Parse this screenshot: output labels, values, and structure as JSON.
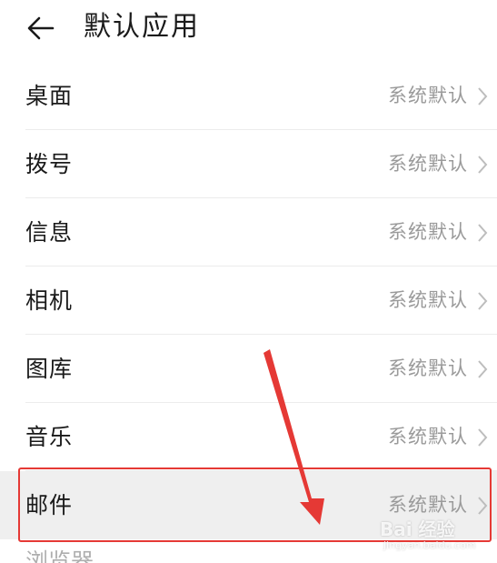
{
  "header": {
    "back_icon": "arrow-left-icon",
    "title": "默认应用"
  },
  "items": [
    {
      "label": "桌面",
      "value": "系统默认"
    },
    {
      "label": "拨号",
      "value": "系统默认"
    },
    {
      "label": "信息",
      "value": "系统默认"
    },
    {
      "label": "相机",
      "value": "系统默认"
    },
    {
      "label": "图库",
      "value": "系统默认"
    },
    {
      "label": "音乐",
      "value": "系统默认"
    },
    {
      "label": "邮件",
      "value": "系统默认"
    }
  ],
  "partial_item": {
    "label": "浏览器"
  },
  "watermark": {
    "text": "Bai 经验",
    "sub": "jingyan.baidu.com"
  },
  "colors": {
    "annotation": "#e53935",
    "highlight_bg": "#efefef",
    "value_text": "#9a9a9a"
  }
}
